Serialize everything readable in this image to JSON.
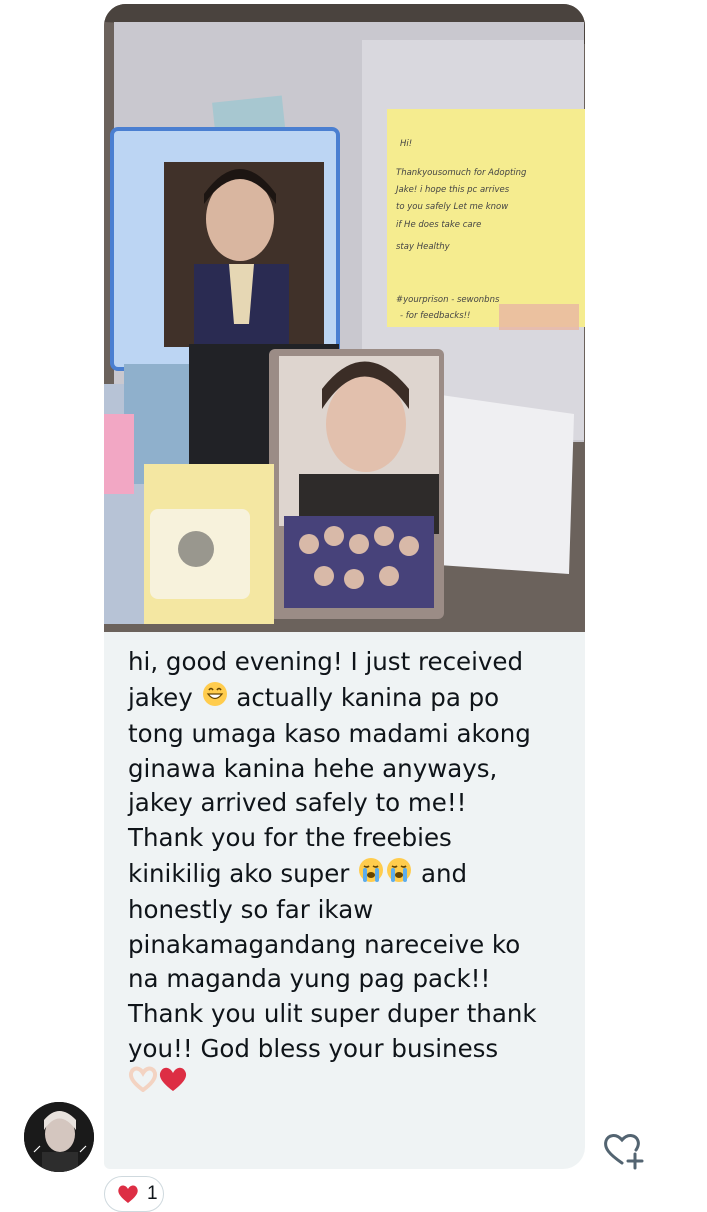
{
  "message": {
    "lines": [
      "hi, good evening! I just received",
      "actually kanina pa po",
      "tong umaga kaso madami akong",
      "ginawa kanina hehe anyways,",
      "jakey arrived safely to me!!",
      "Thank you for the freebies",
      "kinikilig ako super",
      "and",
      "honestly so far ikaw",
      "pinakamagandang nareceive ko",
      "na maganda yung pag pack!!",
      "Thank you ulit super duper thank",
      "you!! God bless your business"
    ],
    "first_word_line2": "jakey"
  },
  "photo": {
    "note_lines": [
      "Hi!",
      "Thankyousomuch for Adopting",
      "Jake! i hope this pc arrives",
      "to you safely Let me know",
      "if He does    take care",
      "stay Healthy",
      "#yourprison       - sewonbns",
      "- for feedbacks!!"
    ]
  },
  "reaction": {
    "emoji": "heart",
    "count": "1"
  },
  "icons": {
    "add_reaction": "heart-plus-icon",
    "avatar": "user-avatar"
  },
  "colors": {
    "bubble": "#eff3f4",
    "heart": "#e0245e",
    "sticky_note": "#f5ec8f",
    "text": "#0f1419"
  }
}
